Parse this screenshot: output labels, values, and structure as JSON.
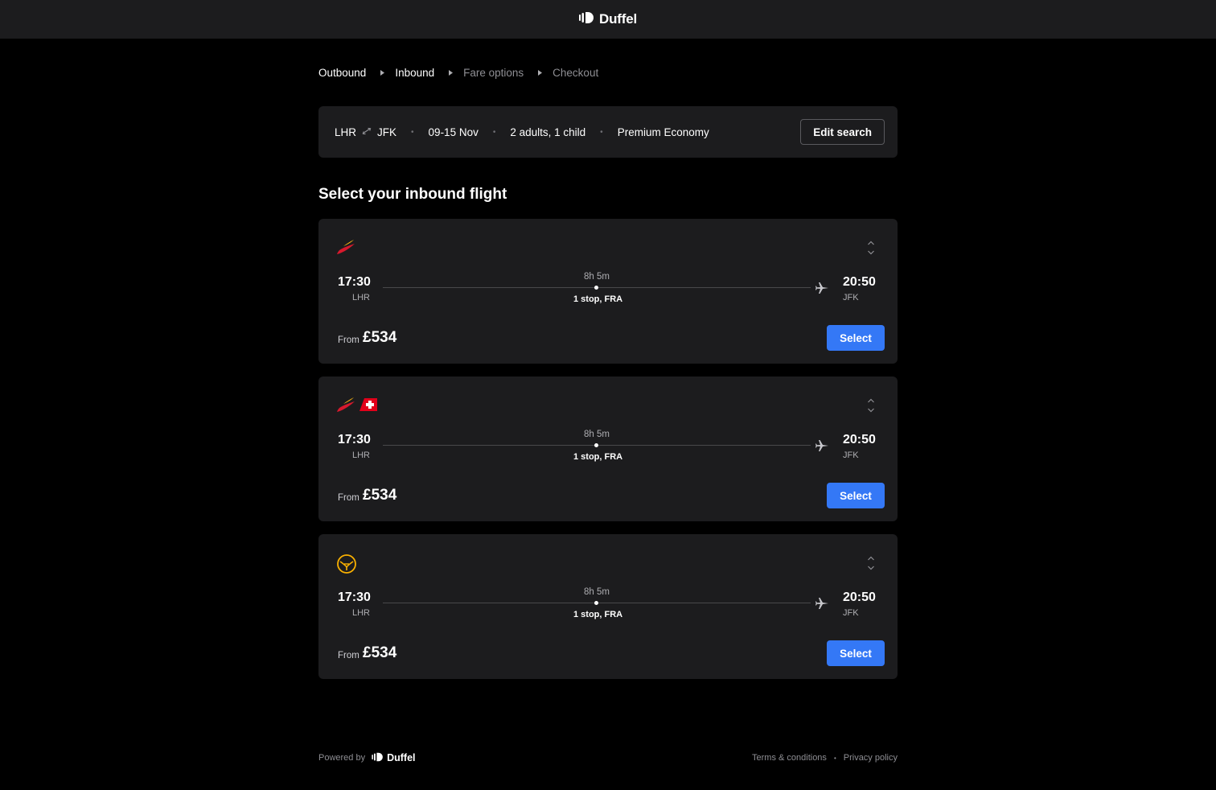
{
  "header": {
    "brand": "Duffel"
  },
  "breadcrumb": {
    "items": [
      {
        "label": "Outbound"
      },
      {
        "label": "Inbound"
      },
      {
        "label": "Fare options"
      },
      {
        "label": "Checkout"
      }
    ]
  },
  "search_summary": {
    "origin": "LHR",
    "destination": "JFK",
    "dates": "09-15 Nov",
    "passengers": "2 adults, 1 child",
    "cabin": "Premium Economy",
    "edit_label": "Edit search"
  },
  "page_title": "Select your inbound flight",
  "flights": [
    {
      "airline_logos": [
        "iberia-logo"
      ],
      "departure_time": "17:30",
      "departure_code": "LHR",
      "arrival_time": "20:50",
      "arrival_code": "JFK",
      "duration": "8h 5m",
      "stops": "1 stop, FRA",
      "from_label": "From",
      "price": "£534",
      "select_label": "Select"
    },
    {
      "airline_logos": [
        "iberia-logo",
        "swiss-logo"
      ],
      "departure_time": "17:30",
      "departure_code": "LHR",
      "arrival_time": "20:50",
      "arrival_code": "JFK",
      "duration": "8h 5m",
      "stops": "1 stop, FRA",
      "from_label": "From",
      "price": "£534",
      "select_label": "Select"
    },
    {
      "airline_logos": [
        "lufthansa-logo"
      ],
      "departure_time": "17:30",
      "departure_code": "LHR",
      "arrival_time": "20:50",
      "arrival_code": "JFK",
      "duration": "8h 5m",
      "stops": "1 stop, FRA",
      "from_label": "From",
      "price": "£534",
      "select_label": "Select"
    }
  ],
  "footer": {
    "powered_by": "Powered by",
    "brand": "Duffel",
    "terms": "Terms & conditions",
    "privacy": "Privacy policy"
  },
  "colors": {
    "background": "#000000",
    "surface": "#1c1c1e",
    "accent": "#3478f6",
    "muted_text": "#8e8e93",
    "iberia_red": "#d7192d",
    "iberia_yellow": "#fcb813",
    "swiss_red": "#e2001a",
    "lufthansa_yellow": "#f9b000"
  }
}
